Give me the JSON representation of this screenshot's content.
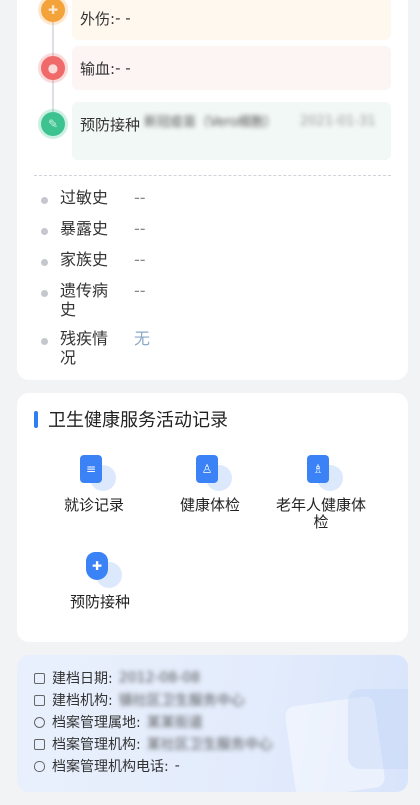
{
  "history": {
    "timeline": [
      {
        "label": "外伤:",
        "value": "- -",
        "icon": "first-aid-icon",
        "color": "#f5a23a",
        "bg": "#fff8ee"
      },
      {
        "label": "输血:",
        "value": "- -",
        "icon": "blood-drop-icon",
        "color": "#f06a6a",
        "bg": "#fdf4f4"
      },
      {
        "label": "预防接种",
        "value": "新冠疫苗（Vero细胞）",
        "date": "2021-01-31",
        "icon": "syringe-icon",
        "color": "#3cc391",
        "bg": "#f2f8f5"
      }
    ],
    "rows": [
      {
        "label": "过敏史",
        "value": "--"
      },
      {
        "label": "暴露史",
        "value": "--"
      },
      {
        "label": "家族史",
        "value": "--"
      },
      {
        "label": "遗传病史",
        "value": "--"
      },
      {
        "label": "残疾情况",
        "value": "无"
      }
    ]
  },
  "service": {
    "title": "卫生健康服务活动记录",
    "items": [
      {
        "label": "就诊记录",
        "icon": "medical-record-icon"
      },
      {
        "label": "健康体检",
        "icon": "physical-exam-icon"
      },
      {
        "label": "老年人健康体检",
        "icon": "elderly-exam-icon"
      },
      {
        "label": "预防接种",
        "icon": "vaccine-shield-icon"
      }
    ]
  },
  "archive": {
    "rows": [
      {
        "label": "建档日期:",
        "value": "2012-08-08",
        "icon": "calendar-icon",
        "blurred": true
      },
      {
        "label": "建档机构:",
        "value": "镇社区卫生服务中心",
        "icon": "building-icon",
        "blurred": true
      },
      {
        "label": "档案管理属地:",
        "value": "某某街道",
        "icon": "location-icon",
        "blurred": true
      },
      {
        "label": "档案管理机构:",
        "value": "某社区卫生服务中心",
        "icon": "folder-icon",
        "blurred": true
      },
      {
        "label": "档案管理机构电话:",
        "value": "-",
        "icon": "phone-icon",
        "blurred": false
      }
    ]
  },
  "colors": {
    "accent": "#2f7cf6"
  }
}
